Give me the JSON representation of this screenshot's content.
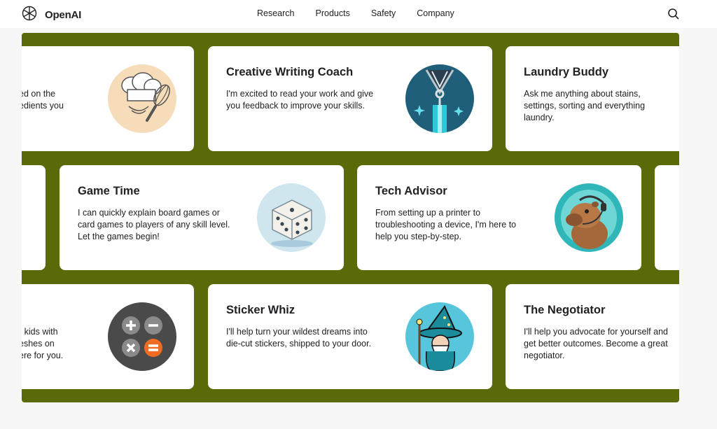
{
  "brand": {
    "name": "OpenAI",
    "logo_icon": "openai-logo-icon"
  },
  "nav": {
    "items": [
      "Research",
      "Products",
      "Safety",
      "Company"
    ]
  },
  "header": {
    "search_icon": "search-icon"
  },
  "colors": {
    "stage_bg": "#5a6a08",
    "card_bg": "#ffffff",
    "page_bg": "#f7f7f8"
  },
  "cards": [
    {
      "title": "",
      "desc": "ed on the\nedients you",
      "icon": "chef-hat-whisk-icon"
    },
    {
      "title": "Creative Writing Coach",
      "desc": "I'm excited to read your work and give you feedback to improve your skills.",
      "icon": "fountain-pen-icon"
    },
    {
      "title": "Laundry Buddy",
      "desc": "Ask me anything about stains, settings, sorting and everything laundry.",
      "icon": ""
    },
    {
      "title": "",
      "desc": "",
      "icon": ""
    },
    {
      "title": "Game Time",
      "desc": "I can quickly explain board games or card games to players of any skill level. Let the games begin!",
      "icon": "dice-icon"
    },
    {
      "title": "Tech Advisor",
      "desc": "From setting up a printer to troubleshooting a device, I'm here to help you step-by-step.",
      "icon": "capybara-headset-icon"
    },
    {
      "title": "",
      "desc": "",
      "icon": ""
    },
    {
      "title": "",
      "desc": "r kids with\neshes on\nere for you.",
      "icon": "calculator-icon"
    },
    {
      "title": "Sticker Whiz",
      "desc": "I'll help turn your wildest dreams into die-cut stickers, shipped to your door.",
      "icon": "wizard-sticker-icon"
    },
    {
      "title": "The Negotiator",
      "desc": "I'll help you advocate for yourself and get better outcomes. Become a great negotiator.",
      "icon": ""
    }
  ]
}
